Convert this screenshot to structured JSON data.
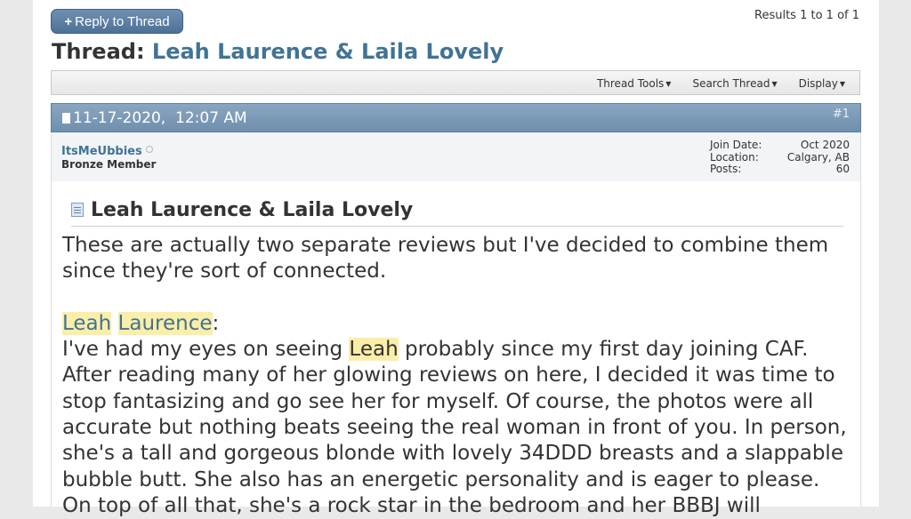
{
  "toolbar": {
    "reply_label": "Reply to Thread",
    "results_text": "Results 1 to 1 of 1"
  },
  "thread": {
    "prefix": "Thread:",
    "title": "Leah Laurence & Laila Lovely"
  },
  "thread_tools": {
    "thread_tools": "Thread Tools",
    "search_thread": "Search Thread",
    "display": "Display"
  },
  "post": {
    "date": "11-17-2020,",
    "time": "12:07 AM",
    "number": "#1",
    "username": "ItsMeUbbies",
    "user_title": "Bronze Member",
    "info": [
      {
        "label": "Join Date:",
        "value": "Oct 2020"
      },
      {
        "label": "Location:",
        "value": "Calgary, AB"
      },
      {
        "label": "Posts:",
        "value": "60"
      }
    ],
    "title": "Leah Laurence & Laila Lovely",
    "intro": "These are actually two separate reviews but I've decided to combine them since they're sort of connected.",
    "section_name_first": "Leah",
    "section_name_last": "Laurence",
    "section_colon": ":",
    "body_before": "I've had my eyes on seeing ",
    "body_highlight": "Leah",
    "body_after": " probably since my first day joining CAF. After reading many of her glowing reviews on here, I decided it was time to stop fantasizing and go see her for myself. Of course, the photos were all accurate but nothing beats seeing the real woman in front of you. In person, she's a tall and gorgeous blonde with lovely 34DDD breasts and a slappable bubble butt. She also has an energetic personality and is eager to please. On top of all that, she's a rock star in the bedroom and her BBBJ will"
  },
  "colors": {
    "link": "#417394",
    "highlight": "#fbeea8",
    "post_header": "#7a98b6"
  }
}
